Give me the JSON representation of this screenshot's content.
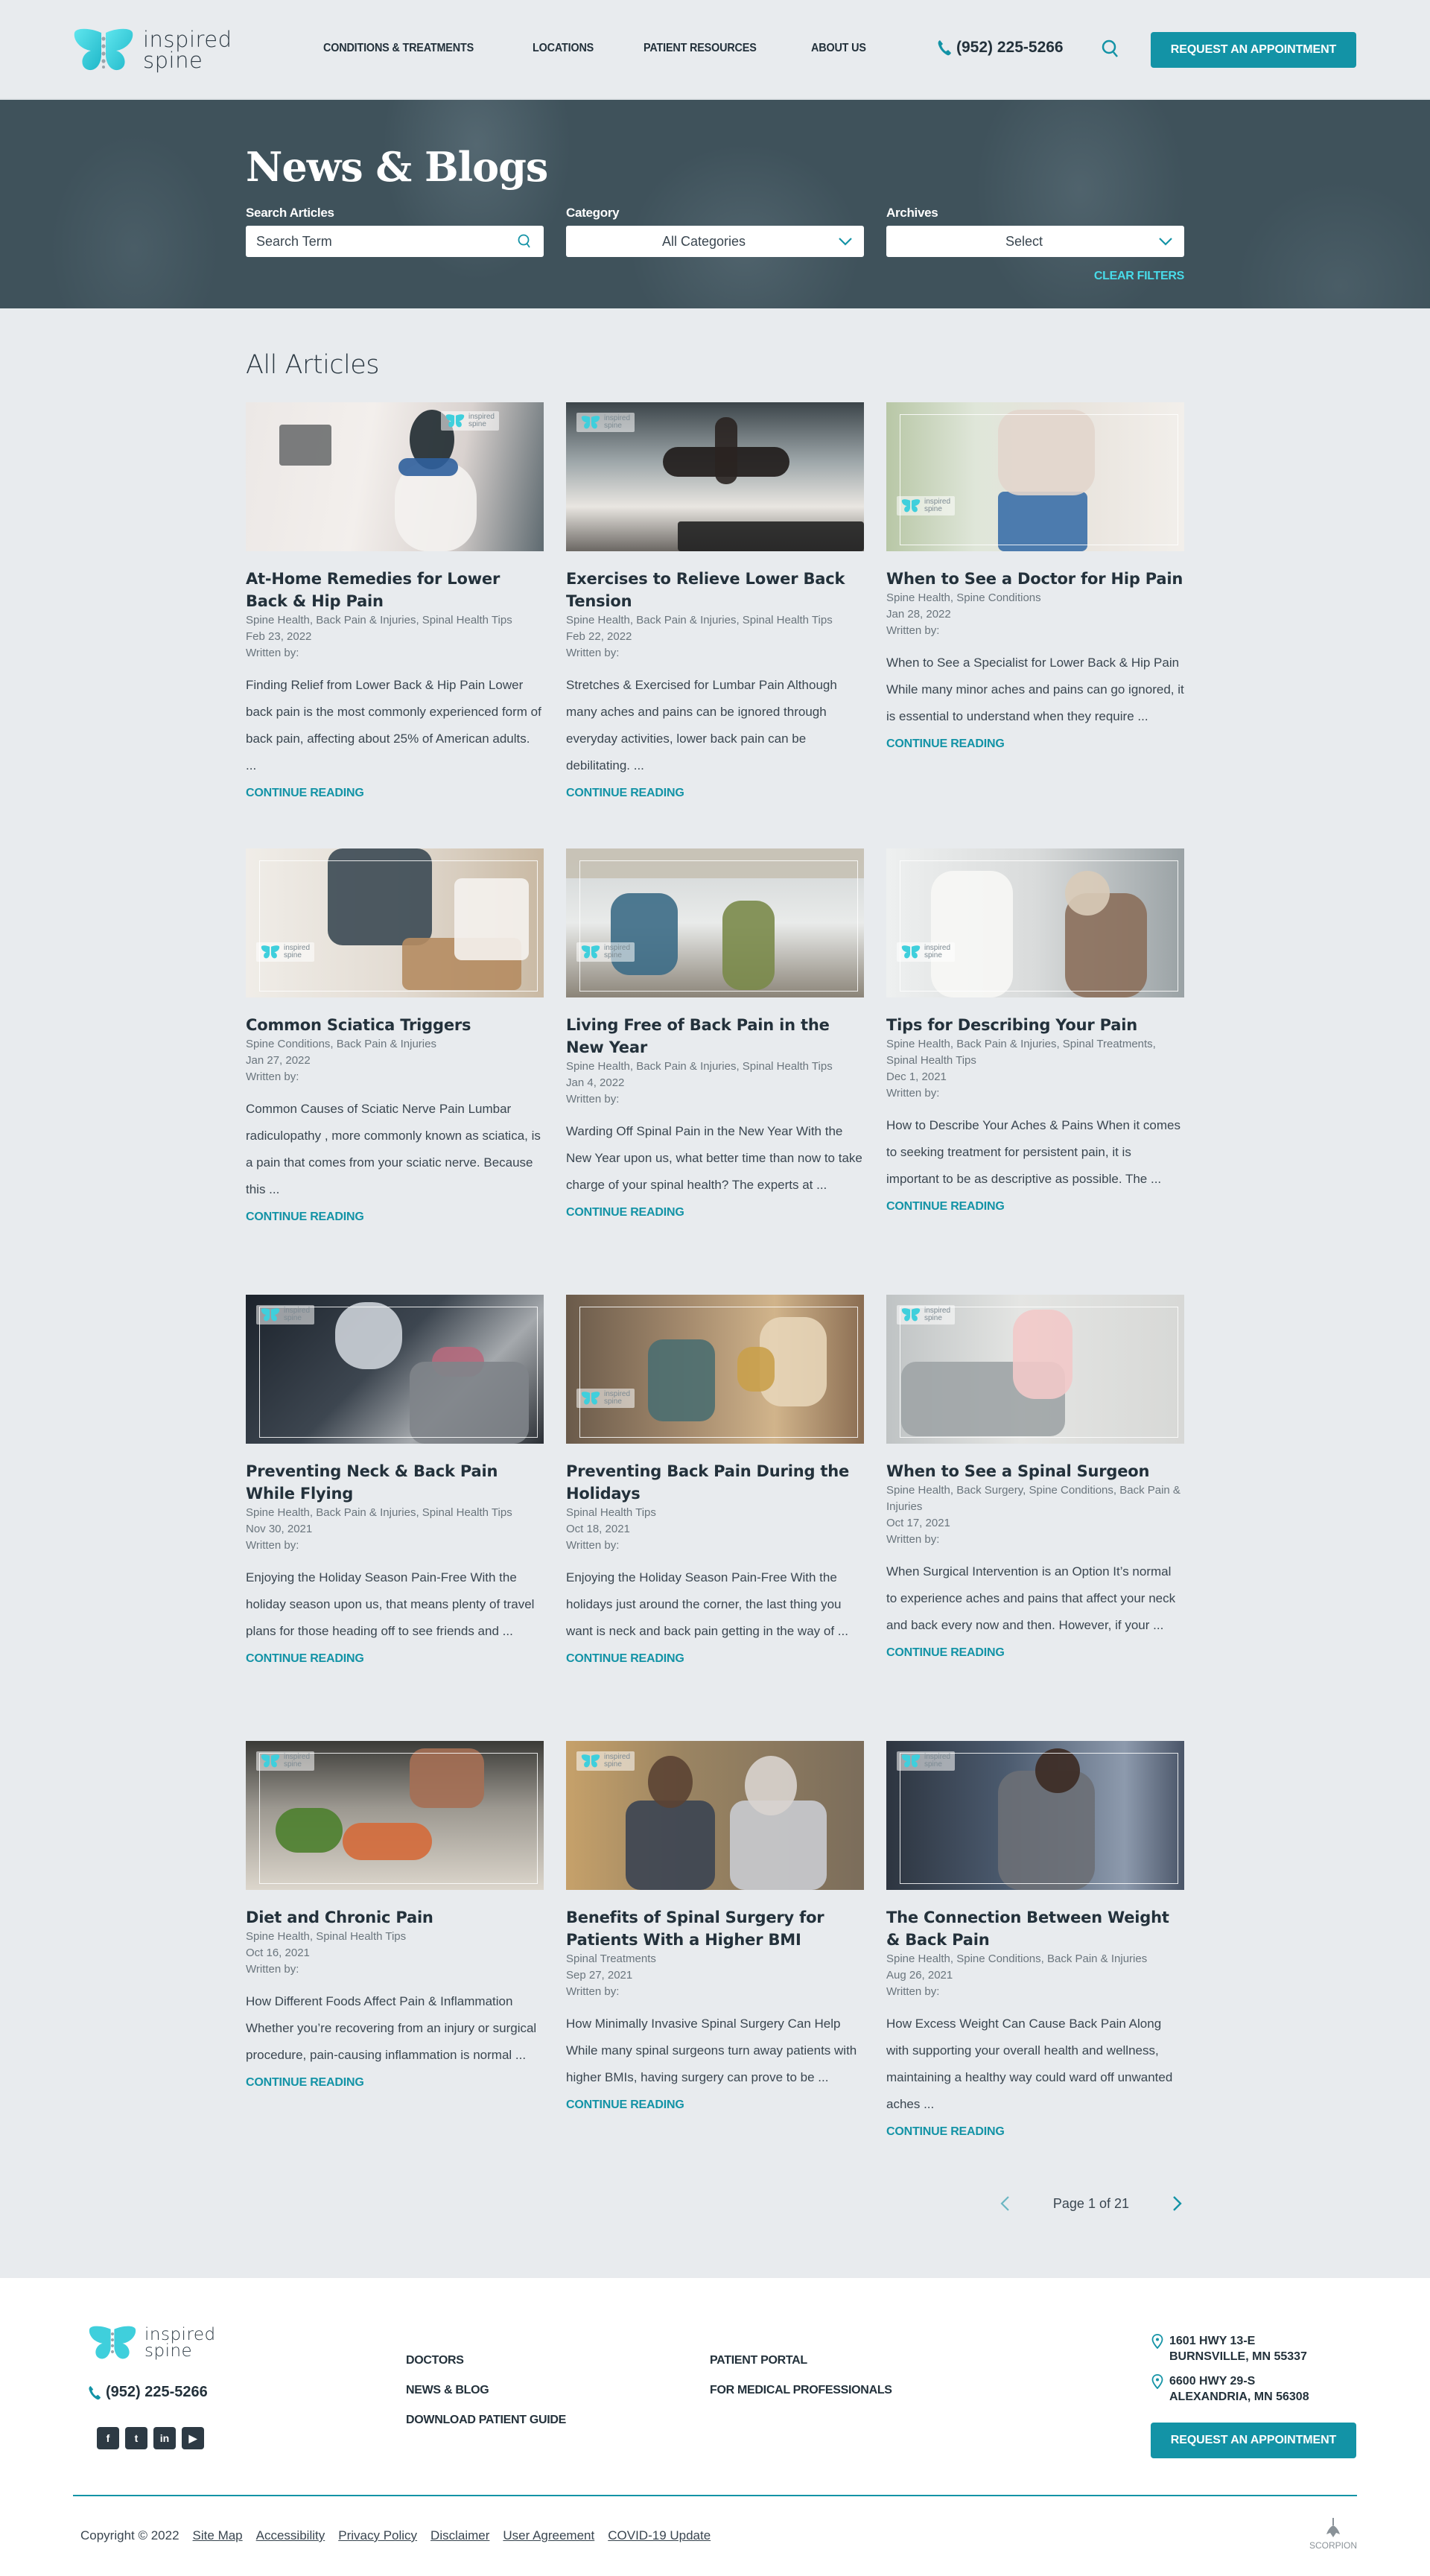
{
  "brand": {
    "name_line1": "inspired",
    "name_line2": "spine",
    "accent": "#1393a6",
    "accent_light": "#48dbe9"
  },
  "header": {
    "nav": [
      "CONDITIONS & TREATMENTS",
      "LOCATIONS",
      "PATIENT RESOURCES",
      "ABOUT US"
    ],
    "phone": "(952) 225-5266",
    "phone_icon": "phone-icon",
    "search_icon": "search-icon",
    "cta": "REQUEST AN APPOINTMENT"
  },
  "hero": {
    "title": "News & Blogs",
    "search": {
      "label": "Search Articles",
      "placeholder": "Search Term",
      "icon": "search-icon"
    },
    "category": {
      "label": "Category",
      "value": "All Categories",
      "icon": "chevron-down-icon"
    },
    "archives": {
      "label": "Archives",
      "value": "Select",
      "icon": "chevron-down-icon"
    },
    "clear": "CLEAR FILTERS"
  },
  "main": {
    "title": "All Articles",
    "written_by": "Written by:",
    "continue": "CONTINUE READING",
    "articles": [
      {
        "title": "At-Home Remedies for Lower Back & Hip Pain",
        "categories": "Spine Health, Back Pain & Injuries, Spinal Health Tips",
        "date": "Feb 23, 2022",
        "excerpt": "Finding Relief from Lower Back & Hip Pain Lower back pain is the most commonly experienced form of back pain, affecting about 25% of American adults. ...",
        "image": "woman-with-neck-heat-pillow"
      },
      {
        "title": "Exercises to Relieve Lower Back Tension",
        "categories": "Spine Health, Back Pain & Injuries, Spinal Health Tips",
        "date": "Feb 22, 2022",
        "excerpt": "Stretches & Exercised for Lumbar Pain Although many aches and pains can be ignored through everyday activities, lower back pain can be debilitating. ...",
        "image": "woman-stretching-on-floor"
      },
      {
        "title": "When to See a Doctor for Hip Pain",
        "categories": "Spine Health, Spine Conditions",
        "date": "Jan 28, 2022",
        "excerpt": "When to See a Specialist for Lower Back & Hip Pain While many minor aches and pains can go ignored, it is essential to understand when they require ...",
        "image": "person-holding-hip"
      },
      {
        "title": "Common Sciatica Triggers",
        "categories": "Spine Conditions, Back Pain & Injuries",
        "date": "Jan 27, 2022",
        "excerpt": "Common Causes of Sciatic Nerve Pain Lumbar radiculopathy , more commonly known as sciatica, is a pain that comes from your sciatic nerve. Because this ...",
        "image": "man-holding-lower-back"
      },
      {
        "title": "Living Free of Back Pain in the New Year",
        "categories": "Spine Health, Back Pain & Injuries, Spinal Health Tips",
        "date": "Jan 4, 2022",
        "excerpt": "Warding Off Spinal Pain in the New Year With the New Year upon us, what better time than now to take charge of your spinal health? The experts at ...",
        "image": "senior-couple-dancing"
      },
      {
        "title": "Tips for Describing Your Pain",
        "categories": "Spine Health, Back Pain & Injuries, Spinal Treatments, Spinal Health Tips",
        "date": "Dec 1, 2021",
        "excerpt": "How to Describe Your Aches & Pains When it comes to seeking treatment for persistent pain, it is important to be as descriptive as possible. The ...",
        "image": "doctor-with-senior-patient"
      },
      {
        "title": "Preventing Neck & Back Pain While Flying",
        "categories": "Spine Health, Back Pain & Injuries, Spinal Health Tips",
        "date": "Nov 30, 2021",
        "excerpt": "Enjoying the Holiday Season Pain-Free With the holiday season upon us, that means plenty of travel plans for those heading off to see friends and ...",
        "image": "traveler-sleeping-on-plane"
      },
      {
        "title": "Preventing Back Pain During the Holidays",
        "categories": "Spinal Health Tips",
        "date": "Oct 18, 2021",
        "excerpt": "Enjoying the Holiday Season Pain-Free With the holidays just around the corner, the last thing you want is neck and back pain getting in the way of ...",
        "image": "grandparents-with-grandchildren"
      },
      {
        "title": "When to See a Spinal Surgeon",
        "categories": "Spine Health, Back Surgery, Spine Conditions, Back Pain & Injuries",
        "date": "Oct 17, 2021",
        "excerpt": "When Surgical Intervention is an Option It’s normal to experience aches and pains that affect your neck and back every now and then. However, if your ...",
        "image": "woman-on-couch-with-neck-pain"
      },
      {
        "title": "Diet and Chronic Pain",
        "categories": "Spine Health, Spinal Health Tips",
        "date": "Oct 16, 2021",
        "excerpt": "How Different Foods Affect Pain & Inflammation Whether you’re recovering from an injury or surgical procedure, pain-causing inflammation is normal ...",
        "image": "chopping-vegetables"
      },
      {
        "title": "Benefits of Spinal Surgery for Patients With a Higher BMI",
        "categories": "Spinal Treatments",
        "date": "Sep 27, 2021",
        "excerpt": "How Minimally Invasive Spinal Surgery Can Help While many spinal surgeons turn away patients with higher BMIs, having surgery can prove to be ...",
        "image": "smiling-senior-couple"
      },
      {
        "title": "The Connection Between Weight & Back Pain",
        "categories": "Spine Health, Spine Conditions, Back Pain & Injuries",
        "date": "Aug 26, 2021",
        "excerpt": "How Excess Weight Can Cause Back Pain Along with supporting your overall health and wellness, maintaining a healthy way could ward off unwanted aches ...",
        "image": "man-holding-back-by-window"
      }
    ]
  },
  "pagination": {
    "text": "Page 1 of 21",
    "current": 1,
    "total": 21,
    "prev_icon": "chevron-left-icon",
    "next_icon": "chevron-right-icon"
  },
  "footer": {
    "phone": "(952) 225-5266",
    "socials": [
      {
        "name": "facebook-icon",
        "glyph": "f"
      },
      {
        "name": "twitter-icon",
        "glyph": "t"
      },
      {
        "name": "linkedin-icon",
        "glyph": "in"
      },
      {
        "name": "youtube-icon",
        "glyph": "▶"
      }
    ],
    "col1": [
      "DOCTORS",
      "NEWS & BLOG",
      "DOWNLOAD PATIENT GUIDE"
    ],
    "col2": [
      "PATIENT PORTAL",
      "FOR MEDICAL PROFESSIONALS"
    ],
    "addresses": [
      {
        "line1": "1601 HWY 13-E",
        "line2": "BURNSVILLE, MN 55337"
      },
      {
        "line1": "6600 HWY 29-S",
        "line2": "ALEXANDRIA, MN 56308"
      }
    ],
    "cta": "REQUEST AN APPOINTMENT",
    "copyright": "Copyright © 2022",
    "links": [
      "Site Map",
      "Accessibility",
      "Privacy Policy",
      "Disclaimer",
      "User Agreement",
      "COVID-19 Update"
    ],
    "credit": "SCORPION"
  }
}
